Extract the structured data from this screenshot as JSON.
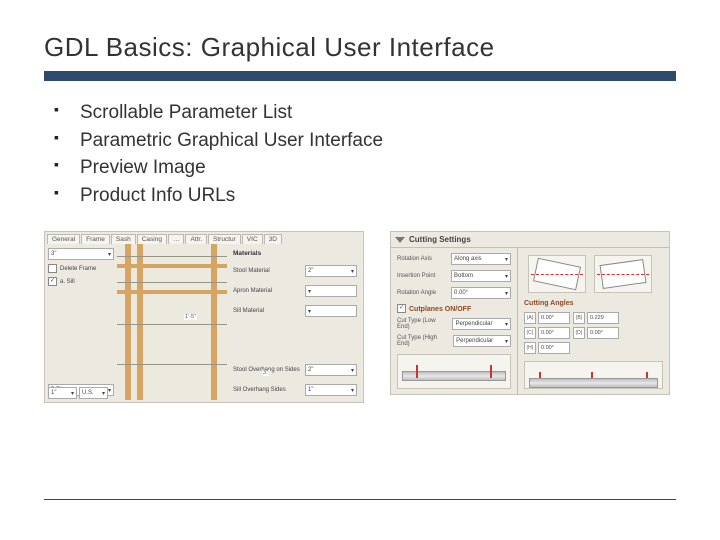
{
  "title": "GDL Basics: Graphical User Interface",
  "bullets": [
    "Scrollable Parameter List",
    "Parametric Graphical User Interface",
    "Preview Image",
    "Product Info URLs"
  ],
  "leftPanel": {
    "tabs": [
      "General",
      "Frame",
      "Sash",
      "Casing",
      "…",
      "Attr.",
      "Structur",
      "VIC",
      "3D"
    ],
    "topSelect": "3\"",
    "cbFrame": {
      "label": "Delete Frame",
      "checked": false
    },
    "cbSill": {
      "label": "a. Sill",
      "checked": true
    },
    "midSelect": "5.5\"",
    "bottomA": "1\"",
    "bottomB": "U.S.",
    "dim1": "1'-5\"",
    "dim2": "3\"",
    "materialsHeader": "Materials",
    "fields": [
      {
        "label": "Stool Material",
        "value": "2\""
      },
      {
        "label": "Apron Material",
        "value": " "
      },
      {
        "label": "Sill Material",
        "value": " "
      },
      {
        "label": "Stool Overhang on Sides",
        "value": "2\""
      },
      {
        "label": "Sill Overhang Sides",
        "value": "1\""
      }
    ]
  },
  "rightPanel": {
    "header": "Cutting Settings",
    "leftCol": {
      "rows": [
        {
          "label": "Rotation Axis",
          "value": "Along axis"
        },
        {
          "label": "Insertion Point",
          "value": "Bottom"
        },
        {
          "label": "Rotation Angle",
          "value": "0.00°"
        }
      ],
      "cutplanes": {
        "label": "Cutplanes ON/OFF",
        "checked": true
      },
      "typeRow": {
        "label": "Cut Type (Low End)",
        "value": "Perpendicular"
      },
      "typeRow2": {
        "label": "Cut Type (High End)",
        "value": "Perpendicular"
      }
    },
    "rightCol": {
      "anglesHeader": "Cutting Angles",
      "nums": [
        {
          "tag": "(A)",
          "val": "0.00°"
        },
        {
          "tag": "(B)",
          "val": "0.229"
        },
        {
          "tag": "(C)",
          "val": "0.00°"
        },
        {
          "tag": "(D)",
          "val": "0.00°"
        },
        {
          "tag": "(H)",
          "val": "0.00°"
        }
      ]
    }
  }
}
